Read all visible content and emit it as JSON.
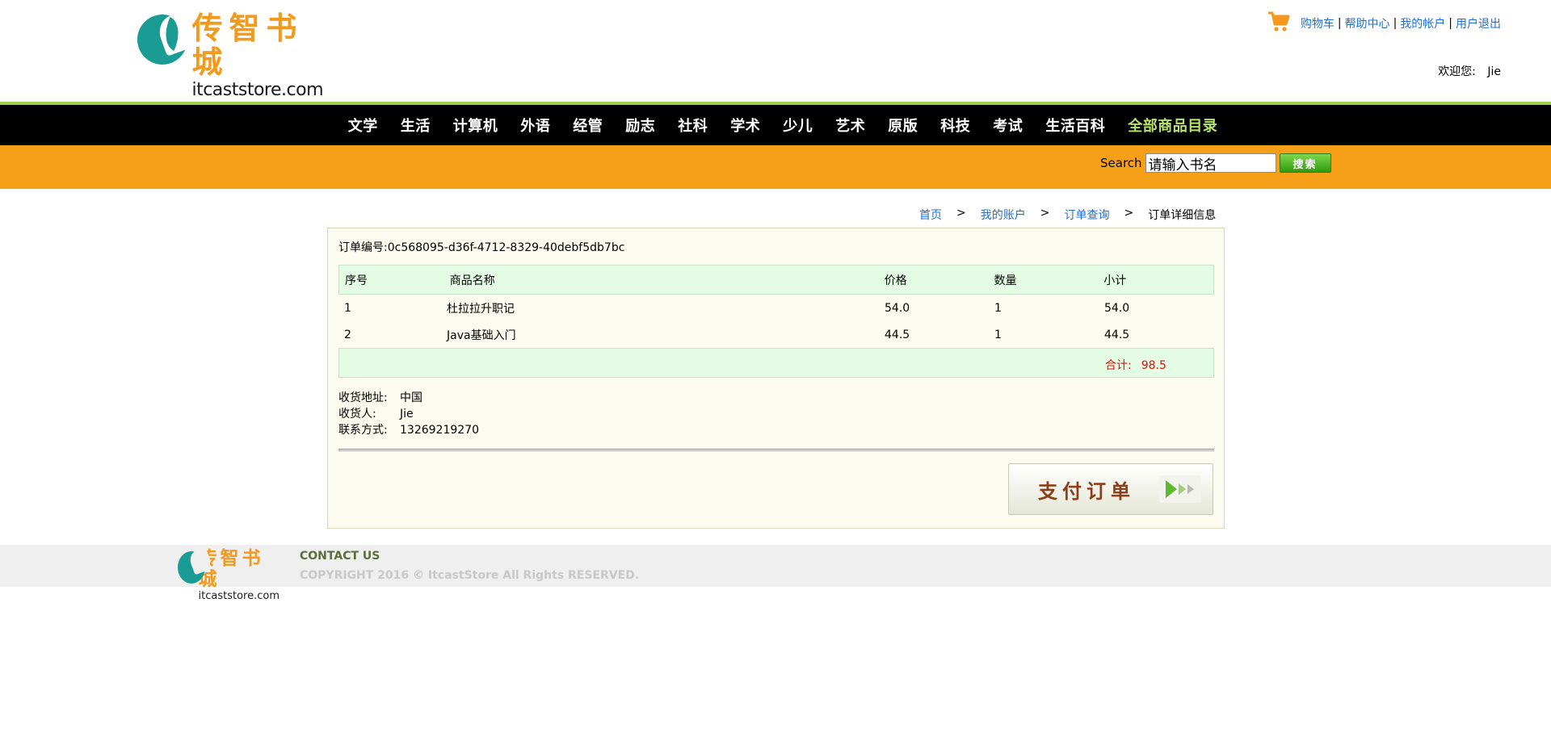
{
  "header": {
    "logo": {
      "cn": "传智书城",
      "en": "itcaststore.com"
    },
    "links": [
      "购物车",
      "帮助中心",
      "我的帐户",
      "用户退出"
    ],
    "separator": "|",
    "welcome_label": "欢迎您:",
    "username": "Jie"
  },
  "nav": {
    "items": [
      "文学",
      "生活",
      "计算机",
      "外语",
      "经管",
      "励志",
      "社科",
      "学术",
      "少儿",
      "艺术",
      "原版",
      "科技",
      "考试",
      "生活百科"
    ],
    "all_label": "全部商品目录"
  },
  "search": {
    "label": "Search",
    "value": "请输入书名",
    "button": "搜索"
  },
  "breadcrumb": {
    "items": [
      "首页",
      "我的账户",
      "订单查询"
    ],
    "separator": ">",
    "current": "订单详细信息"
  },
  "order": {
    "number_label": "订单编号:",
    "number": "0c568095-d36f-4712-8329-40debf5db7bc",
    "columns": [
      "序号",
      "商品名称",
      "价格",
      "数量",
      "小计"
    ],
    "rows": [
      {
        "no": "1",
        "name": "杜拉拉升职记",
        "price": "54.0",
        "qty": "1",
        "subtotal": "54.0"
      },
      {
        "no": "2",
        "name": "Java基础入门",
        "price": "44.5",
        "qty": "1",
        "subtotal": "44.5"
      }
    ],
    "total_label": "合计:",
    "total": "98.5",
    "shipping": {
      "address_label": "收货地址:",
      "address": "中国",
      "receiver_label": "收货人:",
      "receiver": "Jie",
      "phone_label": "联系方式:",
      "phone": "13269219270"
    },
    "pay_button": "支付订单"
  },
  "footer": {
    "logo": {
      "cn": "传智书城",
      "en": "itcaststore.com"
    },
    "contact": "CONTACT US",
    "copyright": "COPYRIGHT 2016 © ItcastStore All Rights RESERVED."
  },
  "colors": {
    "orange": "#f6a01a",
    "nav_bg": "#000000",
    "nav_accent": "#9bd14b",
    "table_header": "#e3fce3",
    "total_red": "#e01010",
    "link_blue": "#1f6fd6"
  }
}
